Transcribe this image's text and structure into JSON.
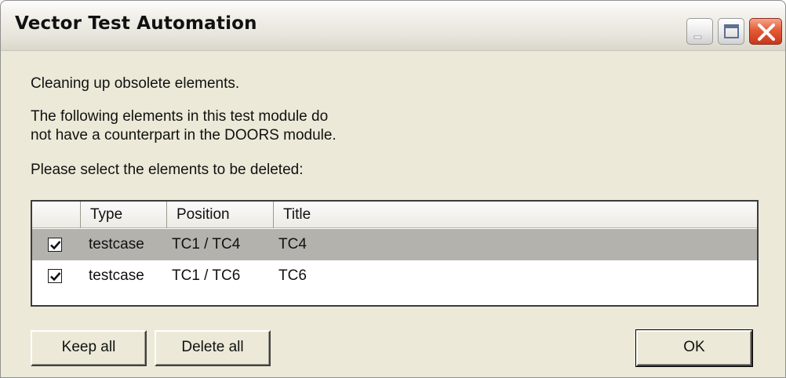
{
  "window": {
    "title": "Vector Test Automation"
  },
  "caption_buttons": {
    "minimize_icon": "minimize-icon",
    "maximize_icon": "maximize-icon",
    "close_icon": "close-icon",
    "close_color": "#e45a36"
  },
  "message": {
    "line1": "Cleaning up obsolete elements.",
    "line2": "The following elements in this test module do",
    "line3": "not have a counterpart in the DOORS module.",
    "line4": "Please select the elements to be deleted:"
  },
  "list": {
    "columns": [
      "",
      "Type",
      "Position",
      "Title"
    ],
    "rows": [
      {
        "checked": true,
        "selected": true,
        "type": "testcase",
        "position": "TC1 / TC4",
        "title": "TC4"
      },
      {
        "checked": true,
        "selected": false,
        "type": "testcase",
        "position": "TC1 / TC6",
        "title": "TC6"
      }
    ],
    "selected_row_color": "#b4b2ad"
  },
  "buttons": {
    "keep_all": "Keep all",
    "delete_all": "Delete all",
    "ok": "OK"
  },
  "colors": {
    "dialog_bg": "#ece9d8"
  }
}
